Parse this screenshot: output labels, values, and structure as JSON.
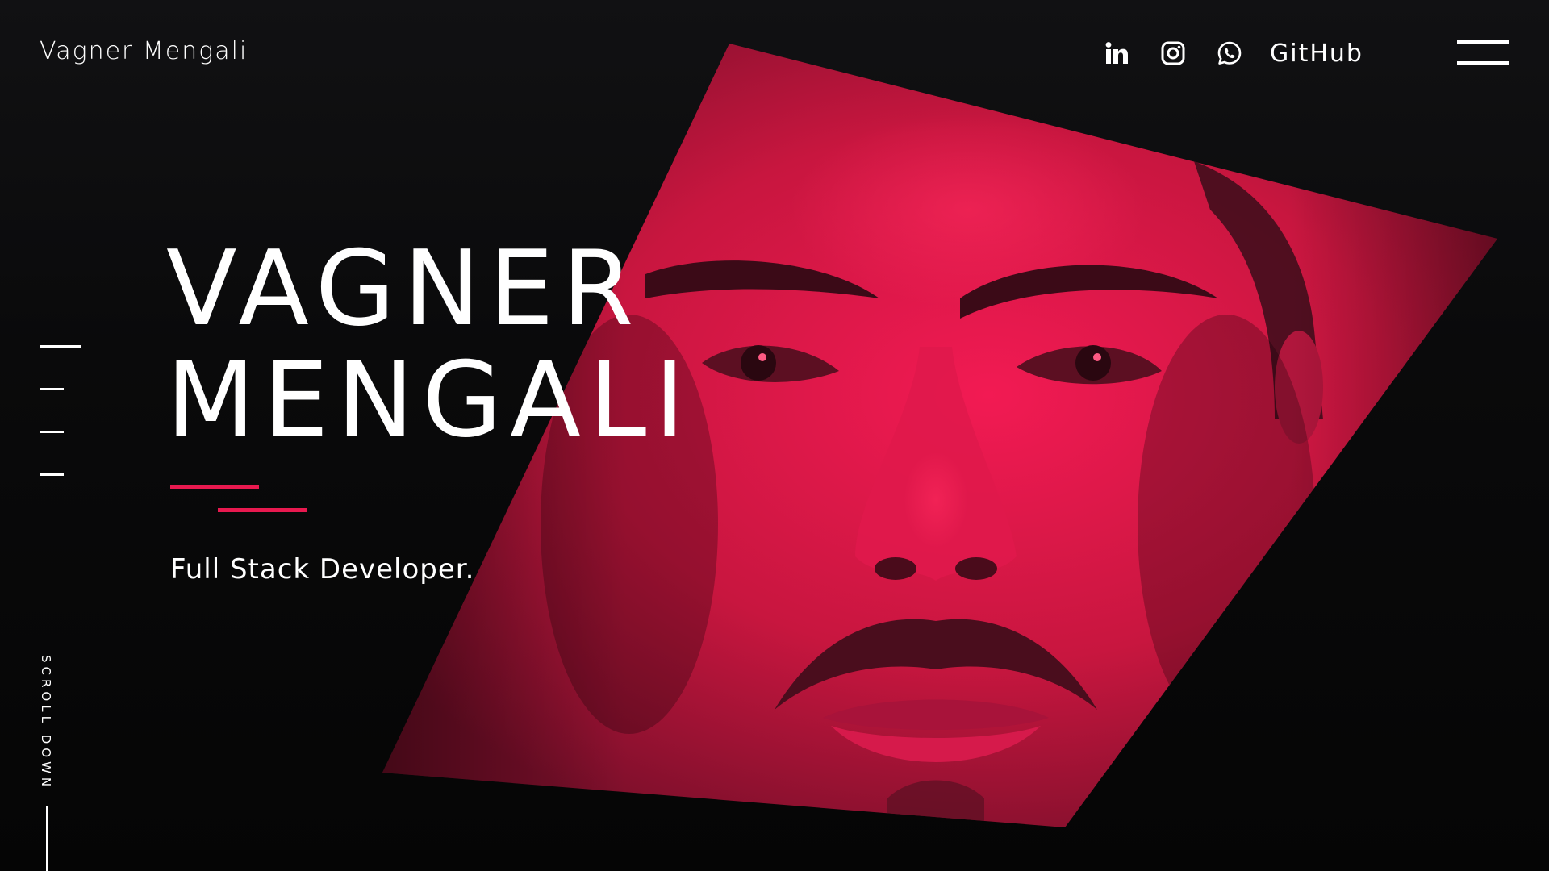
{
  "header": {
    "brand": "Vagner Mengali",
    "social": [
      {
        "icon": "linkedin-icon"
      },
      {
        "icon": "instagram-icon"
      },
      {
        "icon": "whatsapp-icon"
      }
    ],
    "github_label": "GitHub",
    "menu_icon": "hamburger-menu-icon"
  },
  "hero": {
    "title_line1": "VAGNER",
    "title_line2": "MENGALI",
    "subtitle": "Full Stack Developer.",
    "accent_color": "#e8194f",
    "image_tint": "#f0174f"
  },
  "pager": {
    "total": 4,
    "active_index": 0
  },
  "scroll_label": "SCROLL DOWN"
}
